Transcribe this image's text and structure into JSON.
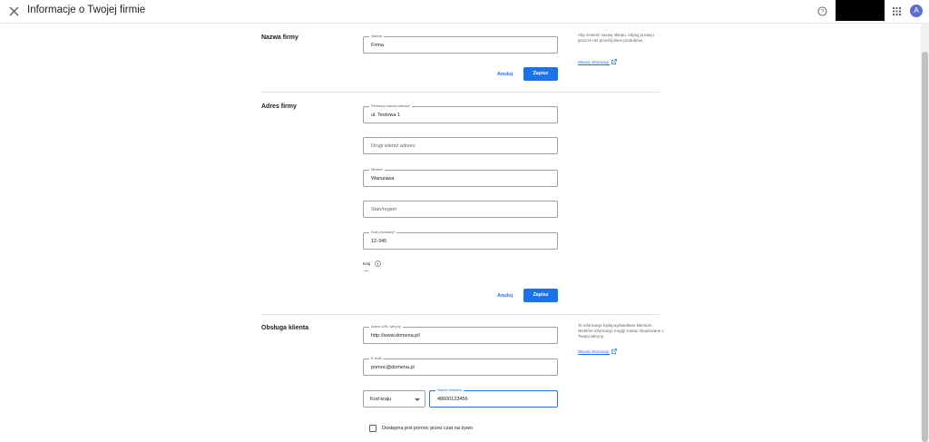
{
  "header": {
    "title": "Informacje o Twojej firmie",
    "avatar_letter": "A"
  },
  "sections": {
    "name": {
      "title": "Nazwa firmy",
      "field_label": "Nazwa",
      "field_value": "Firma",
      "cancel": "Anuluj",
      "save": "Zapisz",
      "help_text": "Aby zmienić nazwę sklepu, edytuj ją tutaj i jeszcze raz prześlij dane produktów.",
      "help_link": "Więcej informacji"
    },
    "address": {
      "title": "Adres firmy",
      "line1_label": "Pierwszy wiersz adresu*",
      "line1_value": "ul. Testowa 1",
      "line2_placeholder": "Drugi wiersz adresu",
      "city_label": "Miasto*",
      "city_value": "Warszawa",
      "state_placeholder": "Stan/region",
      "postal_label": "Kod pocztowy*",
      "postal_value": "12-345",
      "country_label": "Kraj",
      "country_value": "—",
      "cancel": "Anuluj",
      "save": "Zapisz"
    },
    "support": {
      "title": "Obsługa klienta",
      "url_label": "Adres URL witryny",
      "url_value": "http://www.domena.pl/",
      "email_label": "E-mail",
      "email_value": "pomoc@domena.pl",
      "country_code": "Kod kraju",
      "phone_label": "Numer telefonu",
      "phone_value": "48600123456",
      "help_text": "Te informacje będą wyświetlane klientom. Niektóre informacje mogły zostać skopiowane z Twojej witryny.",
      "help_link": "Więcej informacji",
      "chat_checkbox": "Dostępna jest pomoc przez czat na żywo"
    }
  },
  "colors": {
    "accent": "#1a73e8",
    "avatar": "#5b6fcf"
  }
}
